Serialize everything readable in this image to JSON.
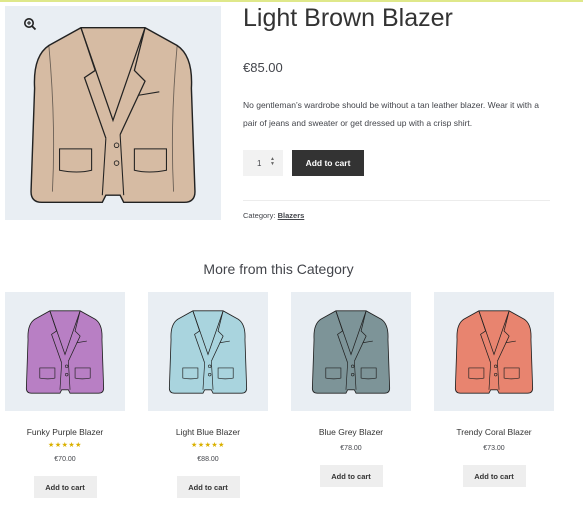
{
  "product": {
    "title": "Light Brown Blazer",
    "price": "€85.00",
    "description": "No gentleman’s wardrobe should be without a tan leather blazer. Wear it with a pair of jeans and sweater or get dressed up with a crisp shirt.",
    "quantity": "1",
    "add_to_cart": "Add to cart",
    "category_label": "Category:",
    "category_link": "Blazers",
    "zoom_icon": "zoom-in-icon",
    "color": "#d6bba3"
  },
  "related": {
    "title": "More from this Category",
    "items": [
      {
        "name": "Funky Purple Blazer",
        "stars": "★★★★★",
        "rating": 5,
        "price": "€70.00",
        "button": "Add to cart",
        "color": "#b87fc4"
      },
      {
        "name": "Light Blue Blazer",
        "stars": "★★★★★",
        "rating": 5,
        "price": "€88.00",
        "button": "Add to cart",
        "color": "#a9d4de"
      },
      {
        "name": "Blue Grey Blazer",
        "stars": "",
        "price": "€78.00",
        "button": "Add to cart",
        "color": "#7d9498"
      },
      {
        "name": "Trendy Coral Blazer",
        "stars": "",
        "price": "€73.00",
        "button": "Add to cart",
        "color": "#e8846f"
      }
    ]
  }
}
